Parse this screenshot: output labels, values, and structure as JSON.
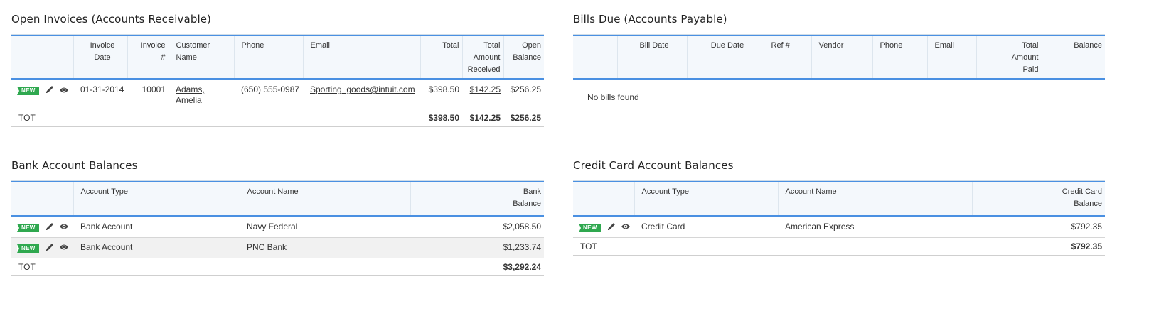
{
  "icons": {
    "new_badge": "NEW",
    "edit": "pencil-icon",
    "view": "eye-icon"
  },
  "colors": {
    "header_accent": "#4a90e2",
    "badge": "#2fa84f"
  },
  "invoices": {
    "title": "Open Invoices (Accounts Receivable)",
    "headers": {
      "invoice_date_1": "Invoice",
      "invoice_date_2": "Date",
      "invoice_num_1": "Invoice",
      "invoice_num_2": "#",
      "customer_1": "Customer",
      "customer_2": "Name",
      "phone": "Phone",
      "email": "Email",
      "total": "Total",
      "received_1": "Total",
      "received_2": "Amount",
      "received_3": "Received",
      "open_1": "Open",
      "open_2": "Balance"
    },
    "rows": [
      {
        "date": "01-31-2014",
        "number": "10001",
        "customer_1": "Adams,",
        "customer_2": "Amelia",
        "phone": "(650) 555-0987",
        "email": "Sporting_goods@intuit.com",
        "total": "$398.50",
        "received": "$142.25",
        "open": "$256.25"
      }
    ],
    "totals": {
      "label": "TOT",
      "total": "$398.50",
      "received": "$142.25",
      "open": "$256.25"
    }
  },
  "bills": {
    "title": "Bills Due (Accounts Payable)",
    "headers": {
      "bill_date": "Bill Date",
      "due_date": "Due Date",
      "ref": "Ref #",
      "vendor": "Vendor",
      "phone": "Phone",
      "email": "Email",
      "paid_1": "Total",
      "paid_2": "Amount",
      "paid_3": "Paid",
      "balance": "Balance"
    },
    "empty_message": "No bills found"
  },
  "bank": {
    "title": "Bank Account Balances",
    "headers": {
      "type": "Account Type",
      "name": "Account Name",
      "balance_1": "Bank",
      "balance_2": "Balance"
    },
    "rows": [
      {
        "type": "Bank Account",
        "name": "Navy Federal",
        "balance": "$2,058.50"
      },
      {
        "type": "Bank Account",
        "name": "PNC Bank",
        "balance": "$1,233.74"
      }
    ],
    "totals": {
      "label": "TOT",
      "balance": "$3,292.24"
    }
  },
  "credit": {
    "title": "Credit Card Account Balances",
    "headers": {
      "type": "Account Type",
      "name": "Account Name",
      "balance_1": "Credit Card",
      "balance_2": "Balance"
    },
    "rows": [
      {
        "type": "Credit Card",
        "name": "American Express",
        "balance": "$792.35"
      }
    ],
    "totals": {
      "label": "TOT",
      "balance": "$792.35"
    }
  }
}
